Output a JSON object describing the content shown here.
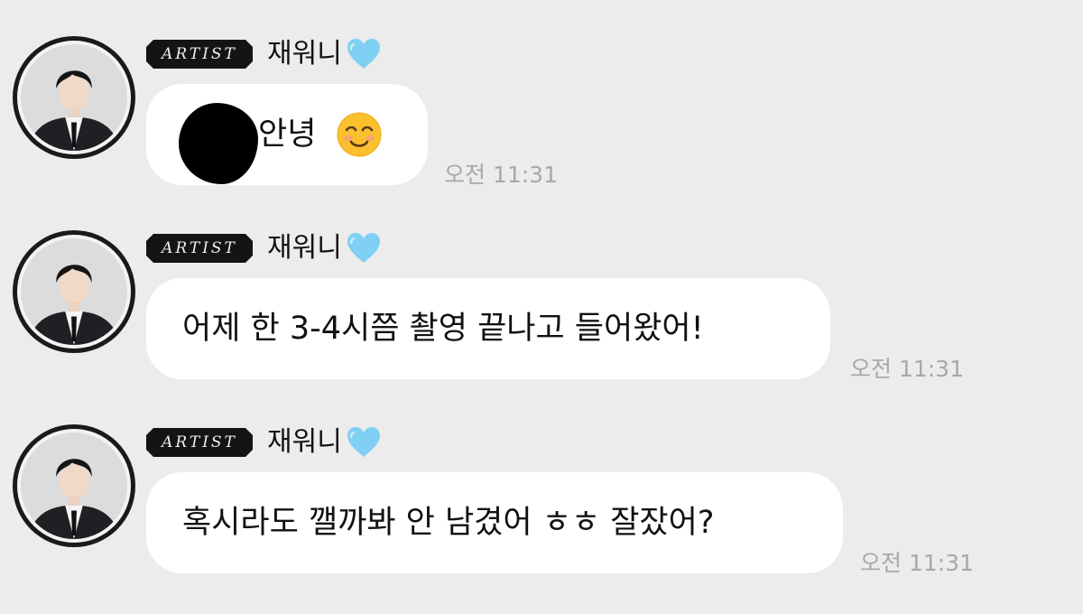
{
  "badge_label": "ARTIST",
  "colors": {
    "background": "#ececec",
    "bubble": "#ffffff",
    "timestamp": "#a8a8a8",
    "heart": "#7fd0f2",
    "badge_bg": "#141414"
  },
  "messages": [
    {
      "sender": "재워니",
      "text": "안녕",
      "time": "오전 11:31",
      "redacted_prefix": true,
      "emoji": "smiling-face-icon"
    },
    {
      "sender": "재워니",
      "text": "어제 한 3-4시쯤 촬영 끝나고 들어왔어!",
      "time": "오전 11:31"
    },
    {
      "sender": "재워니",
      "text": "혹시라도 깰까봐 안 남겼어 ㅎㅎ 잘잤어?",
      "time": "오전 11:31"
    }
  ]
}
